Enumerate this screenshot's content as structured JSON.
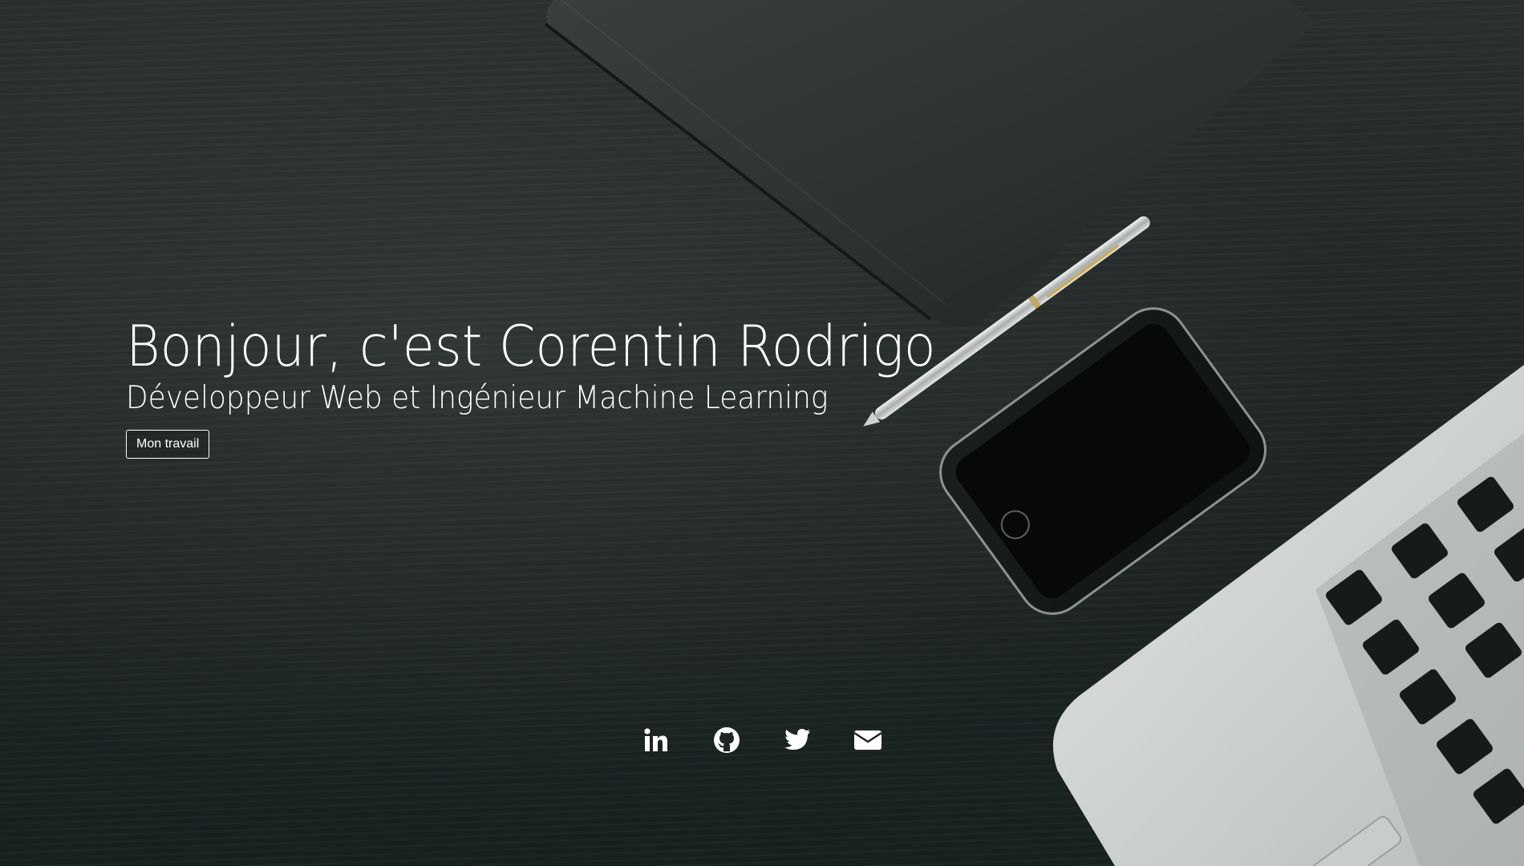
{
  "hero": {
    "title": "Bonjour, c'est Corentin Rodrigo",
    "subtitle": "Développeur Web et Ingénieur Machine Learning",
    "cta_label": "Mon travail"
  },
  "socials": [
    {
      "name": "linkedin",
      "icon": "linkedin-icon"
    },
    {
      "name": "github",
      "icon": "github-icon"
    },
    {
      "name": "twitter",
      "icon": "twitter-icon"
    },
    {
      "name": "email",
      "icon": "envelope-icon"
    }
  ],
  "colors": {
    "background": "#1f2524",
    "text": "#ffffff"
  }
}
